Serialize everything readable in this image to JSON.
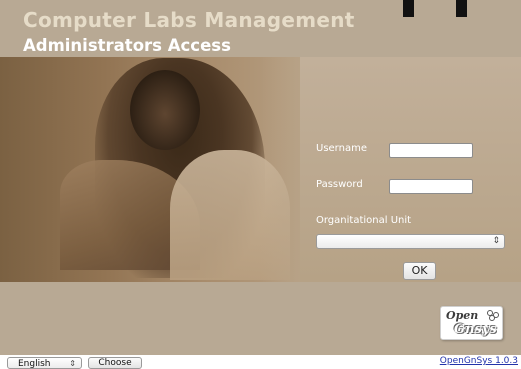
{
  "header": {
    "title": "Computer Labs Management",
    "subtitle": "Administrators Access"
  },
  "login_form": {
    "username_label": "Username",
    "username_value": "",
    "password_label": "Password",
    "password_value": "",
    "ou_label": "Organitational Unit",
    "ou_selected": "",
    "ok_label": "OK"
  },
  "logo": {
    "line1": "Open",
    "line2": "Gnsys"
  },
  "footer": {
    "language_selected": "English",
    "choose_label": "Choose",
    "version_label": "OpenGnSys 1.0.3"
  },
  "icons": {
    "select_arrow": "updown-arrow-icon"
  },
  "colors": {
    "background": "#b8a994",
    "title": "#e6dcc8",
    "subtitle": "#ffffff",
    "link": "#2233aa"
  }
}
